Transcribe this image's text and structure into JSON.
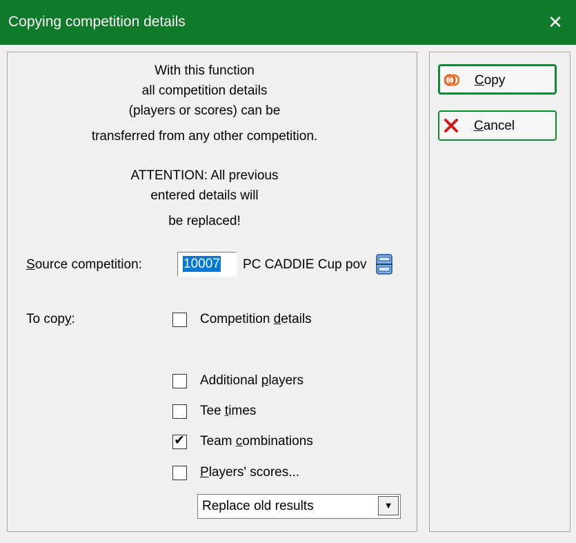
{
  "window": {
    "title": "Copying competition details",
    "close_glyph": "✕"
  },
  "info": {
    "lines": [
      "With this function",
      "all competition details",
      "(players or scores) can be",
      "transferred from any other competition."
    ],
    "attention_lines": [
      "ATTENTION: All previous",
      "entered details will",
      "be replaced!"
    ]
  },
  "source": {
    "label_prefix": "S",
    "label_rest": "ource competition:",
    "number": "10007",
    "name": "PC CADDIE Cup pov",
    "lookup_icon": "lookup-list-icon"
  },
  "to_copy": {
    "label_prefix": "To cop",
    "label_underline": "y",
    "label_suffix": ":",
    "options": [
      {
        "pre": "Competition ",
        "ul": "d",
        "post": "etails",
        "checked": false
      },
      {
        "pre": "Additional ",
        "ul": "p",
        "post": "layers",
        "checked": false
      },
      {
        "pre": "Tee ",
        "ul": "t",
        "post": "imes",
        "checked": false
      },
      {
        "pre": "Team ",
        "ul": "c",
        "post": "ombinations",
        "checked": true
      },
      {
        "pre": "",
        "ul": "P",
        "post": "layers' scores...",
        "checked": false
      }
    ],
    "check_glyph": "✔"
  },
  "results_mode": {
    "selected": "Replace old results",
    "arrow_glyph": "▼"
  },
  "buttons": {
    "copy": {
      "ul": "C",
      "rest": "opy",
      "icon": "copy-rings-icon"
    },
    "cancel": {
      "ul": "C",
      "rest": "ancel",
      "icon": "red-x-icon"
    }
  },
  "colors": {
    "titlebar": "#0e7a2a",
    "button_border": "#0e8a2e",
    "selection": "#0078d7"
  }
}
